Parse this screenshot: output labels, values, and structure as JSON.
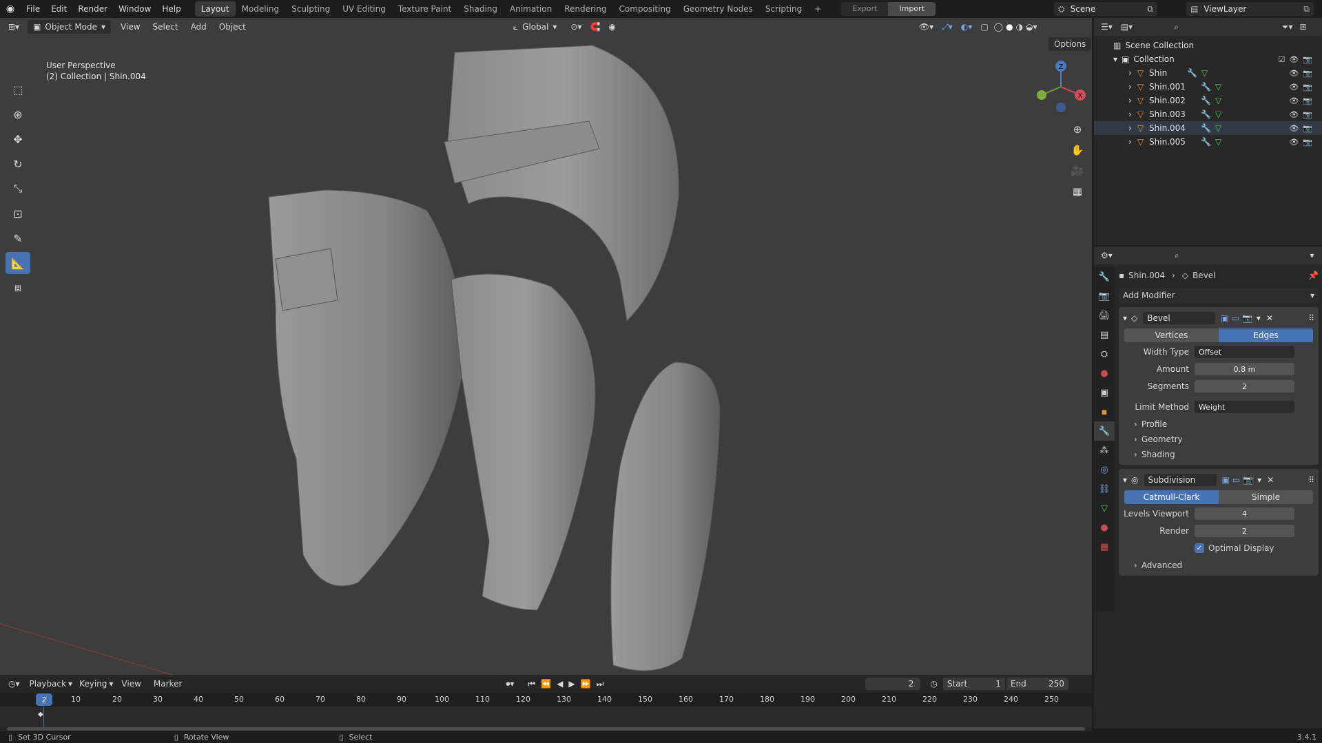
{
  "menu": [
    "File",
    "Edit",
    "Render",
    "Window",
    "Help"
  ],
  "workspaces": [
    "Layout",
    "Modeling",
    "Sculpting",
    "UV Editing",
    "Texture Paint",
    "Shading",
    "Animation",
    "Rendering",
    "Compositing",
    "Geometry Nodes",
    "Scripting"
  ],
  "active_workspace": "Layout",
  "add_workspace": "+",
  "export_label": "Export",
  "import_label": "Import",
  "scene_name": "Scene",
  "view_layer": "ViewLayer",
  "viewport_header": {
    "mode": "Object Mode",
    "menus": [
      "View",
      "Select",
      "Add",
      "Object"
    ],
    "orientation": "Global",
    "options": "Options"
  },
  "viewport": {
    "perspective": "User Perspective",
    "collection_info": "(2) Collection | Shin.004",
    "background": "#3d3d3d"
  },
  "gizmo": {
    "z": "Z",
    "x": "X"
  },
  "outliner": {
    "scene_collection": "Scene Collection",
    "collection": "Collection",
    "objects": [
      "Shin",
      "Shin.001",
      "Shin.002",
      "Shin.003",
      "Shin.004",
      "Shin.005"
    ],
    "selected": "Shin.004"
  },
  "properties": {
    "breadcrumb_object": "Shin.004",
    "breadcrumb_modifier": "Bevel",
    "add_modifier": "Add Modifier",
    "bevel": {
      "name": "Bevel",
      "affect_options": [
        "Vertices",
        "Edges"
      ],
      "affect_selected": "Edges",
      "width_type_label": "Width Type",
      "width_type": "Offset",
      "amount_label": "Amount",
      "amount": "0.8 m",
      "segments_label": "Segments",
      "segments": "2",
      "limit_method_label": "Limit Method",
      "limit_method": "Weight",
      "subpanels": [
        "Profile",
        "Geometry",
        "Shading"
      ]
    },
    "subdivision": {
      "name": "Subdivision",
      "modes": [
        "Catmull-Clark",
        "Simple"
      ],
      "mode_selected": "Catmull-Clark",
      "levels_viewport_label": "Levels Viewport",
      "levels_viewport": "4",
      "render_label": "Render",
      "render": "2",
      "optimal_display_label": "Optimal Display",
      "optimal_display": true,
      "advanced": "Advanced"
    }
  },
  "timeline": {
    "menus": [
      "Playback",
      "Keying",
      "View",
      "Marker"
    ],
    "current_frame": "2",
    "start_label": "Start",
    "start": "1",
    "end_label": "End",
    "end": "250",
    "ticks": [
      "2",
      "10",
      "20",
      "30",
      "40",
      "50",
      "60",
      "70",
      "80",
      "90",
      "100",
      "110",
      "120",
      "130",
      "140",
      "150",
      "160",
      "170",
      "180",
      "190",
      "200",
      "210",
      "220",
      "230",
      "240",
      "250"
    ]
  },
  "status": {
    "left": "Set 3D Cursor",
    "middle": "Rotate View",
    "right": "Select",
    "version": "3.4.1"
  },
  "colors": {
    "accent": "#4772b3",
    "object_orange": "#e8953a",
    "mesh_green": "#5ec26a"
  }
}
